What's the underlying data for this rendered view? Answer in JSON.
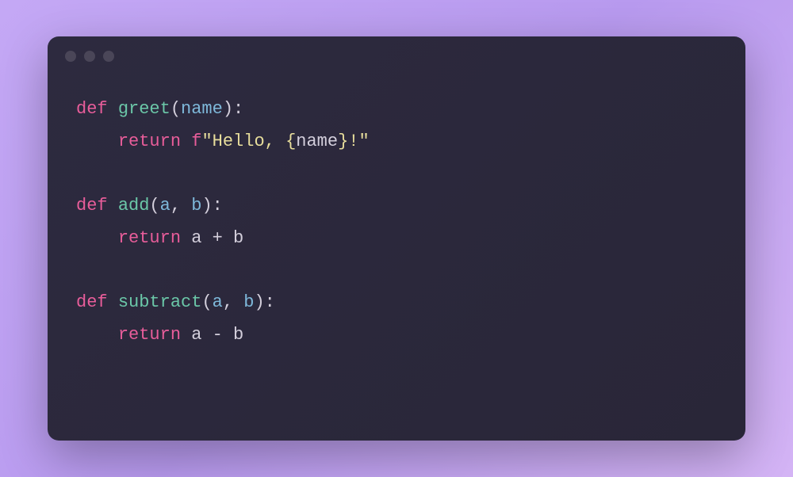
{
  "code": {
    "line1": {
      "keyword": "def",
      "funcname": "greet",
      "lparen": "(",
      "param": "name",
      "rparen": ")",
      "colon": ":"
    },
    "line2": {
      "indent": "    ",
      "keyword": "return",
      "fprefix": "f",
      "quote1": "\"",
      "str1": "Hello, ",
      "lbrace": "{",
      "interp": "name",
      "rbrace": "}",
      "str2": "!",
      "quote2": "\""
    },
    "line4": {
      "keyword": "def",
      "funcname": "add",
      "lparen": "(",
      "param1": "a",
      "comma": ", ",
      "param2": "b",
      "rparen": ")",
      "colon": ":"
    },
    "line5": {
      "indent": "    ",
      "keyword": "return",
      "var1": "a",
      "op": " + ",
      "var2": "b"
    },
    "line7": {
      "keyword": "def",
      "funcname": "subtract",
      "lparen": "(",
      "param1": "a",
      "comma": ", ",
      "param2": "b",
      "rparen": ")",
      "colon": ":"
    },
    "line8": {
      "indent": "    ",
      "keyword": "return",
      "var1": "a",
      "op": " - ",
      "var2": "b"
    }
  }
}
